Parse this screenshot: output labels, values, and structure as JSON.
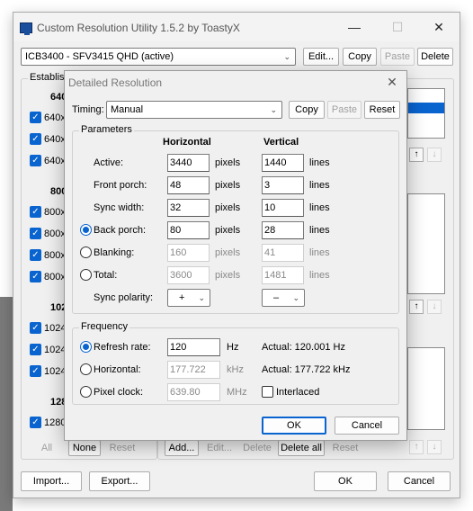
{
  "window": {
    "title": "Custom Resolution Utility 1.5.2 by ToastyX",
    "minimize": "—",
    "maximize": "☐",
    "close": "✕"
  },
  "toolbar": {
    "monitor": "ICB3400 - SFV3415 QHD (active)",
    "edit": "Edit...",
    "copy": "Copy",
    "paste": "Paste",
    "delete": "Delete"
  },
  "established": {
    "title": "Establis",
    "groups": [
      {
        "header": "640",
        "items": [
          "640x",
          "640x",
          "640x"
        ]
      },
      {
        "header": "800",
        "items": [
          "800x",
          "800x",
          "800x",
          "800x"
        ]
      },
      {
        "header": "102",
        "items": [
          "1024",
          "1024",
          "1024"
        ]
      },
      {
        "header": "128",
        "items": [
          "1280"
        ]
      }
    ],
    "all": "All",
    "none": "None",
    "reset": "Reset"
  },
  "right_panel": {
    "add": "Add...",
    "edit": "Edit...",
    "delete": "Delete",
    "delete_all": "Delete all",
    "reset": "Reset",
    "up": "↑",
    "down": "↓"
  },
  "bottom": {
    "import": "Import...",
    "export": "Export...",
    "ok": "OK",
    "cancel": "Cancel"
  },
  "dialog": {
    "title": "Detailed Resolution",
    "close": "✕",
    "timing_label": "Timing:",
    "timing_value": "Manual",
    "copy": "Copy",
    "paste": "Paste",
    "reset": "Reset",
    "parameters_title": "Parameters",
    "horizontal": "Horizontal",
    "vertical": "Vertical",
    "rows": [
      {
        "label": "Active:",
        "h": "3440",
        "hu": "pixels",
        "v": "1440",
        "vu": "lines"
      },
      {
        "label": "Front porch:",
        "h": "48",
        "hu": "pixels",
        "v": "3",
        "vu": "lines"
      },
      {
        "label": "Sync width:",
        "h": "32",
        "hu": "pixels",
        "v": "10",
        "vu": "lines"
      },
      {
        "label": "Back porch:",
        "h": "80",
        "hu": "pixels",
        "v": "28",
        "vu": "lines"
      },
      {
        "label": "Blanking:",
        "h": "160",
        "hu": "pixels",
        "v": "41",
        "vu": "lines"
      },
      {
        "label": "Total:",
        "h": "3600",
        "hu": "pixels",
        "v": "1481",
        "vu": "lines"
      }
    ],
    "sync_polarity_label": "Sync polarity:",
    "sync_h": "+",
    "sync_v": "–",
    "frequency_title": "Frequency",
    "refresh_label": "Refresh rate:",
    "refresh_value": "120",
    "refresh_unit": "Hz",
    "refresh_actual": "Actual: 120.001 Hz",
    "horizontal_label": "Horizontal:",
    "horizontal_value": "177.722",
    "horizontal_unit": "kHz",
    "horizontal_actual": "Actual: 177.722 kHz",
    "pixel_clock_label": "Pixel clock:",
    "pixel_clock_value": "639.80",
    "pixel_clock_unit": "MHz",
    "interlaced": "Interlaced",
    "ok": "OK",
    "cancel": "Cancel"
  }
}
